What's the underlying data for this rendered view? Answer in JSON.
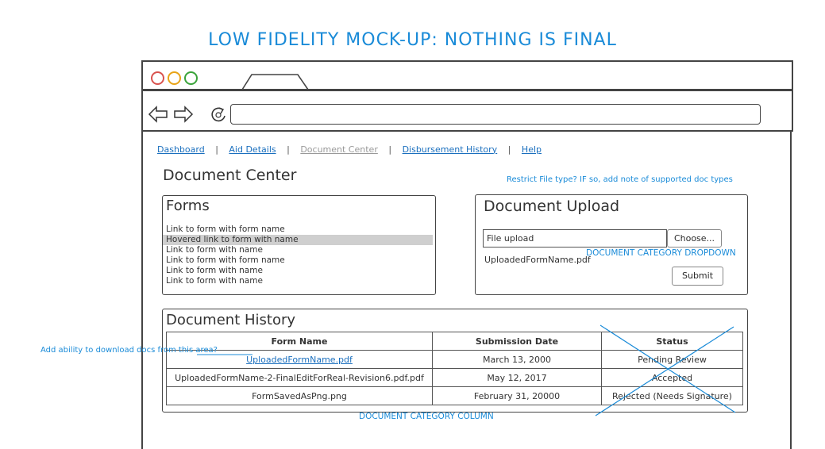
{
  "mockup_title": "LOW FIDELITY MOCK-UP: NOTHING IS FINAL",
  "nav": {
    "dashboard": "Dashboard",
    "aid_details": "Aid Details",
    "document_center": "Document Center",
    "disbursement_history": "Disbursement History",
    "help": "Help",
    "separator": "|"
  },
  "page_title": "Document Center",
  "annotations": {
    "restrict_file_type": "Restrict File type? IF so, add note of supported doc types",
    "category_dropdown": "DOCUMENT CATEGORY DROPDOWN",
    "download_docs": "Add ability to download docs from this area?",
    "category_column": "DOCUMENT CATEGORY COLUMN"
  },
  "forms_panel": {
    "title": "Forms",
    "links": [
      "Link to form with form name",
      "Hovered link to form with name",
      "Link to form with name",
      "Link to form with form name",
      "Link to form with name",
      "Link to form with name"
    ]
  },
  "upload_panel": {
    "title": "Document Upload",
    "file_input_label": "File upload",
    "choose_button": "Choose...",
    "uploaded_file": "UploadedFormName.pdf",
    "submit_button": "Submit"
  },
  "history_panel": {
    "title": "Document History",
    "columns": [
      "Form Name",
      "Submission Date",
      "Status"
    ],
    "rows": [
      {
        "name": "UploadedFormName.pdf",
        "date": "March 13, 2000",
        "status": "Pending Review"
      },
      {
        "name": "UploadedFormName-2-FinalEditForReal-Revision6.pdf.pdf",
        "date": "May 12, 2017",
        "status": "Accepted"
      },
      {
        "name": "FormSavedAsPng.png",
        "date": "February 31, 20000",
        "status": "Rejected (Needs Signature)"
      }
    ]
  },
  "colors": {
    "annotation_blue": "#1a8bd8",
    "dot_red": "#d9534f",
    "dot_orange": "#e8a317",
    "dot_green": "#3aa33a",
    "link_blue": "#1a6fbe"
  }
}
